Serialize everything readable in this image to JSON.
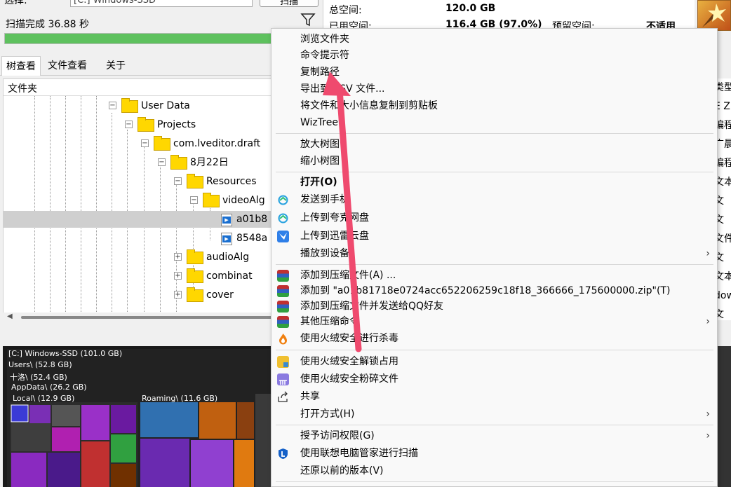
{
  "top": {
    "drive_label": "选择:",
    "drive_value": "[C:] Windows-SSD",
    "scan_button": "扫描",
    "scan_status": "扫描完成 36.88 秒",
    "progress": 1.0
  },
  "stats": {
    "total_label": "总空间:",
    "total_value": "120.0 GB",
    "used_label": "已用空间:",
    "used_value": "116.4 GB  (97.0%)",
    "reserved_label": "预留空间:",
    "reserved_value": "不适用"
  },
  "tabs": [
    "树查看",
    "文件查看",
    "关于"
  ],
  "tree": {
    "header": "文件夹",
    "rows": [
      {
        "label": "User Data",
        "exp": "−"
      },
      {
        "label": "Projects",
        "exp": "−"
      },
      {
        "label": "com.lveditor.draft",
        "exp": "−"
      },
      {
        "label": "8月22日",
        "exp": "−"
      },
      {
        "label": "Resources",
        "exp": "−"
      },
      {
        "label": "videoAlg",
        "exp": "−"
      },
      {
        "label": "a01b8",
        "exp": ""
      },
      {
        "label": "8548a",
        "exp": ""
      },
      {
        "label": "audioAlg",
        "exp": "+"
      },
      {
        "label": "combinat",
        "exp": "+"
      },
      {
        "label": "cover",
        "exp": "+"
      }
    ]
  },
  "right_partial": [
    "类型",
    "E Z",
    "编程",
    "广晨",
    "编程",
    "文本",
    "文",
    "文",
    "文件",
    "文",
    "文本",
    "dow",
    "文"
  ],
  "treemap": {
    "drive": "[C:] Windows-SSD  (101.0 GB)",
    "users": "Users\\ (52.8 GB)",
    "user": "十洛\\ (52.4 GB)",
    "appdata": "AppData\\ (26.2 GB)",
    "local": "Local\\ (12.9 GB)",
    "roaming": "Roaming\\ (11.6 GB)"
  },
  "menu": {
    "browse": "浏览文件夹",
    "cmd": "命令提示符",
    "copy_path": "复制路径",
    "export_csv": "导出到 CSV 文件...",
    "copy_info": "将文件和大小信息复制到剪贴板",
    "wiztree": "WizTree",
    "zoom_in": "放大树图",
    "zoom_out": "缩小树图",
    "open": "打开(O)",
    "send_phone": "发送到手机",
    "upload_quark": "上传到夸克网盘",
    "upload_xunlei": "上传到迅雷云盘",
    "play_device": "播放到设备",
    "add_archive": "添加到压缩文件(A) ...",
    "add_zip": "添加到 \"a01b81718e0724acc652206259c18f18_366666_175600000.zip\"(T)",
    "add_send_qq": "添加到压缩文件并发送给QQ好友",
    "other_compress": "其他压缩命令",
    "huorong_scan": "使用火绒安全进行杀毒",
    "huorong_unlock": "使用火绒安全解锁占用",
    "huorong_shred": "使用火绒安全粉碎文件",
    "share": "共享",
    "open_with": "打开方式(H)",
    "grant_access": "授予访问权限(G)",
    "lenovo_scan": "使用联想电脑管家进行扫描",
    "restore": "还原以前的版本(V)",
    "chevron": "›"
  },
  "colors": {
    "progress": "#5ec15e",
    "annotation_arrow": "#ef4a6e",
    "selection": "#cfcfcf"
  }
}
